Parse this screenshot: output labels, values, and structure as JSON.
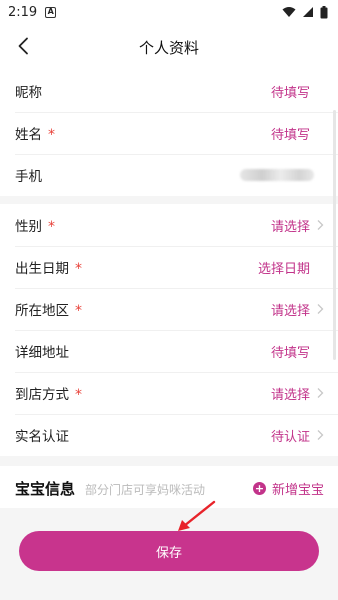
{
  "status_bar": {
    "time": "2:19",
    "notif_glyph": "A"
  },
  "nav": {
    "title": "个人资料"
  },
  "section1": [
    {
      "label": "昵称",
      "required": false,
      "value": "待填写"
    },
    {
      "label": "姓名",
      "required": true,
      "value": "待填写"
    },
    {
      "label": "手机",
      "required": false,
      "value": ""
    }
  ],
  "section2": [
    {
      "label": "性别",
      "required": true,
      "value": "请选择",
      "chevron": true
    },
    {
      "label": "出生日期",
      "required": true,
      "value": "选择日期",
      "chevron": false
    },
    {
      "label": "所在地区",
      "required": true,
      "value": "请选择",
      "chevron": true
    },
    {
      "label": "详细地址",
      "required": false,
      "value": "待填写",
      "chevron": false
    },
    {
      "label": "到店方式",
      "required": true,
      "value": "请选择",
      "chevron": true
    },
    {
      "label": "实名认证",
      "required": false,
      "value": "待认证",
      "chevron": true
    }
  ],
  "baby": {
    "title": "宝宝信息",
    "hint": "部分门店可享妈咪活动",
    "add_label": "新增宝宝"
  },
  "save_label": "保存",
  "required_mark": "*",
  "colors": {
    "accent": "#c2338a",
    "button": "#c8348d",
    "required": "#e8423a"
  },
  "icons": [
    "notification-icon",
    "wifi-icon",
    "signal-icon",
    "battery-icon",
    "back-arrow-icon",
    "chevron-right-icon",
    "plus-circle-icon",
    "red-arrow-annotation"
  ]
}
